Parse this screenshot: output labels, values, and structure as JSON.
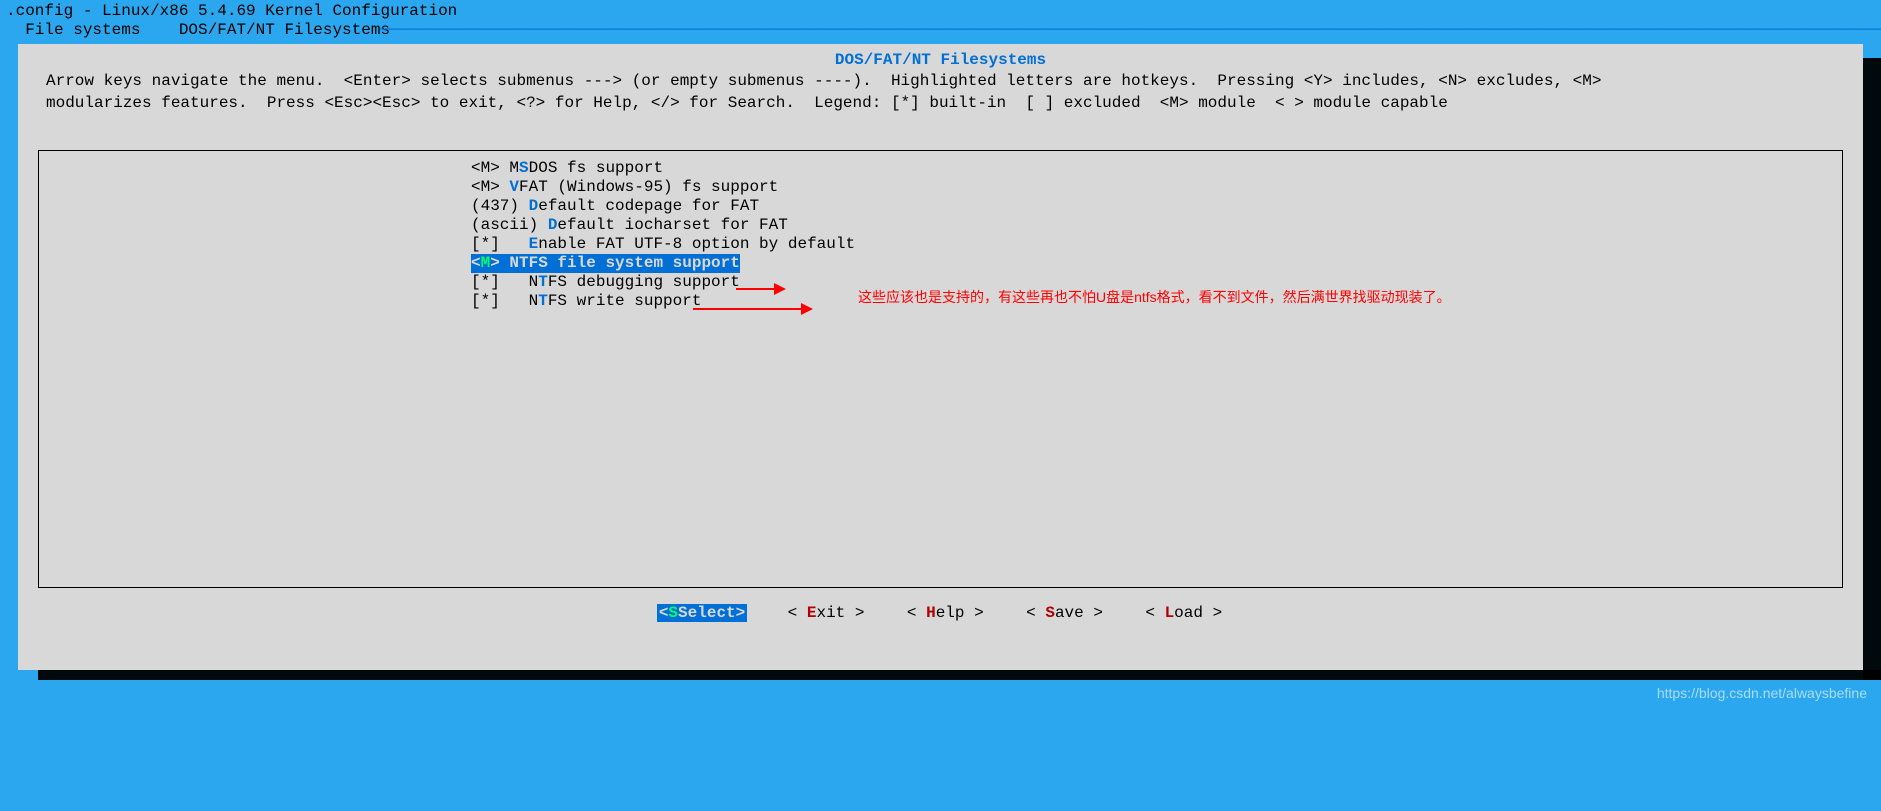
{
  "header": {
    "title": ".config - Linux/x86 5.4.69 Kernel Configuration",
    "crumb1": "File systems",
    "crumb2": "DOS/FAT/NT Filesystems"
  },
  "box": {
    "title": "DOS/FAT/NT Filesystems",
    "help1": "Arrow keys navigate the menu.  <Enter> selects submenus ---> (or empty submenus ----).  Highlighted letters are hotkeys.  Pressing <Y> includes, <N> excludes, <M>",
    "help2": "modularizes features.  Press <Esc><Esc> to exit, <?> for Help, </> for Search.  Legend: [*] built-in  [ ] excluded  <M> module  < > module capable"
  },
  "options": [
    {
      "prefix": "<M> M",
      "hk": "S",
      "rest": "DOS fs support",
      "selected": false
    },
    {
      "prefix": "<M> ",
      "hk": "V",
      "rest": "FAT (Windows-95) fs support",
      "selected": false
    },
    {
      "prefix": "(437) ",
      "hk": "D",
      "rest": "efault codepage for FAT",
      "selected": false
    },
    {
      "prefix": "(ascii) ",
      "hk": "D",
      "rest": "efault iocharset for FAT",
      "selected": false
    },
    {
      "prefix": "[*]   ",
      "hk": "E",
      "rest": "nable FAT UTF-8 option by default",
      "selected": false
    },
    {
      "prefix": "<",
      "hk": "M",
      "rest": "> NTFS file system support",
      "selected": true
    },
    {
      "prefix": "[*]   N",
      "hk": "T",
      "rest": "FS debugging support",
      "selected": false
    },
    {
      "prefix": "[*]   N",
      "hk": "T",
      "rest": "FS write support",
      "selected": false
    }
  ],
  "buttons": {
    "select": "Select",
    "exit": "xit",
    "help": "elp",
    "save": "ave",
    "load": "oad"
  },
  "annotation": "这些应该也是支持的，有这些再也不怕U盘是ntfs格式，看不到文件，然后满世界找驱动现装了。",
  "watermark": "https://blog.csdn.net/alwaysbefine"
}
